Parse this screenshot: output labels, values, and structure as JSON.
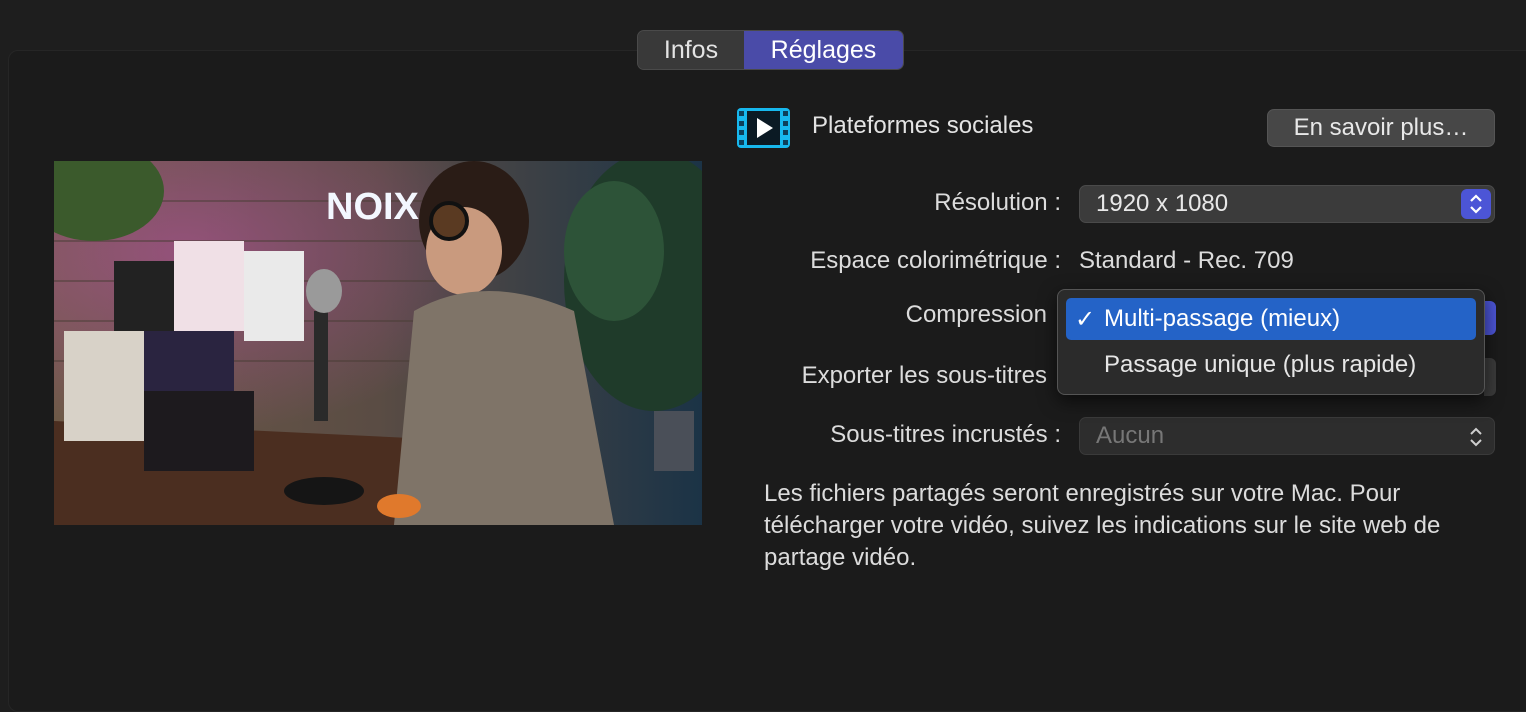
{
  "tabs": {
    "info_label": "Infos",
    "settings_label": "Réglages",
    "selected": "Réglages"
  },
  "header": {
    "title": "Plateformes sociales",
    "icon": "video-play-icon",
    "learn_more_label": "En savoir plus…"
  },
  "fields": {
    "resolution_label": "Résolution :",
    "resolution_value": "1920 x 1080",
    "colorspace_label": "Espace colorimétrique :",
    "colorspace_value": "Standard - Rec. 709",
    "compression_label": "Compression",
    "export_subtitles_label": "Exporter les sous-titres",
    "burned_subtitles_label": "Sous-titres incrustés :",
    "burned_subtitles_value": "Aucun"
  },
  "compression_menu": {
    "options": [
      {
        "label": "Multi-passage (mieux)",
        "checked": true
      },
      {
        "label": "Passage unique (plus rapide)",
        "checked": false
      }
    ],
    "check_glyph": "✓"
  },
  "description": "Les fichiers partagés seront enregistrés sur votre Mac. Pour télécharger votre vidéo, suivez les indications sur le site web de partage vidéo.",
  "preview": {
    "neon_sign": "NOIX"
  },
  "colors": {
    "accent": "#4a4ba8",
    "menu_highlight": "#2463c7",
    "stepper": "#4c55d6"
  }
}
